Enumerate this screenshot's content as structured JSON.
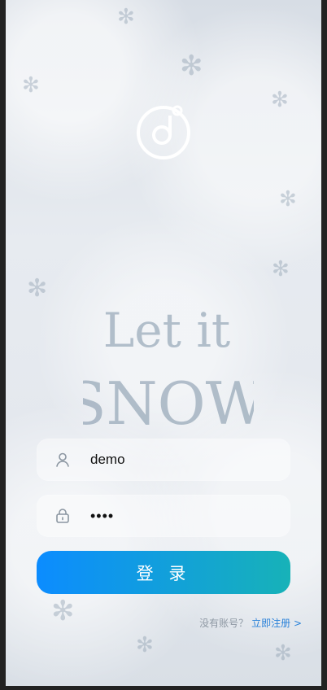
{
  "login": {
    "username_value": "demo",
    "password_value": "••••",
    "button_label": "登 录"
  },
  "signup": {
    "prompt": "没有账号？",
    "link": "立即注册 >"
  },
  "artwork": {
    "line1": "Let it",
    "line2": "SNOW"
  },
  "icons": {
    "logo": "music-note-icon",
    "user": "user-icon",
    "lock": "lock-icon"
  },
  "colors": {
    "button_start": "#0c8cff",
    "button_end": "#17b2b8",
    "link": "#2a82d9"
  }
}
